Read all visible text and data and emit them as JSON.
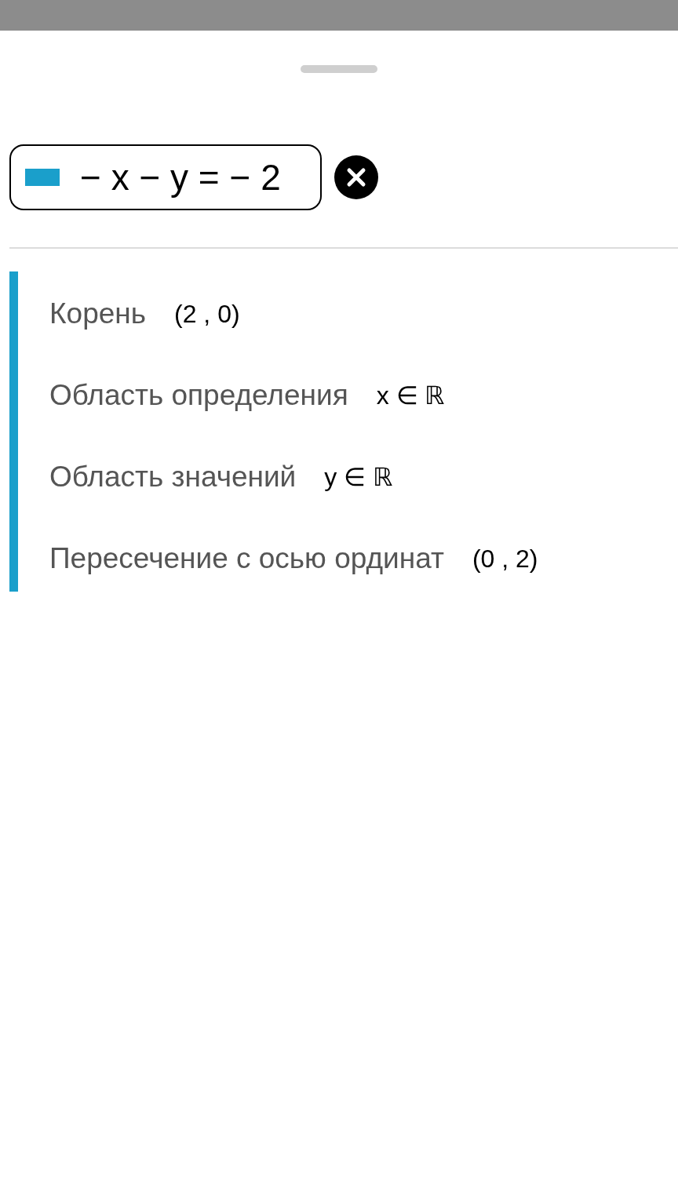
{
  "equation": {
    "text": "− x − y = − 2",
    "color": "#1a9fcb"
  },
  "properties": [
    {
      "label": "Корень",
      "value": "(2 , 0)"
    },
    {
      "label": "Область определения",
      "value": "x ∈ ℝ"
    },
    {
      "label": "Область значений",
      "value": "y ∈ ℝ"
    },
    {
      "label": "Пересечение с осью ординат",
      "value": "(0 , 2)"
    }
  ]
}
